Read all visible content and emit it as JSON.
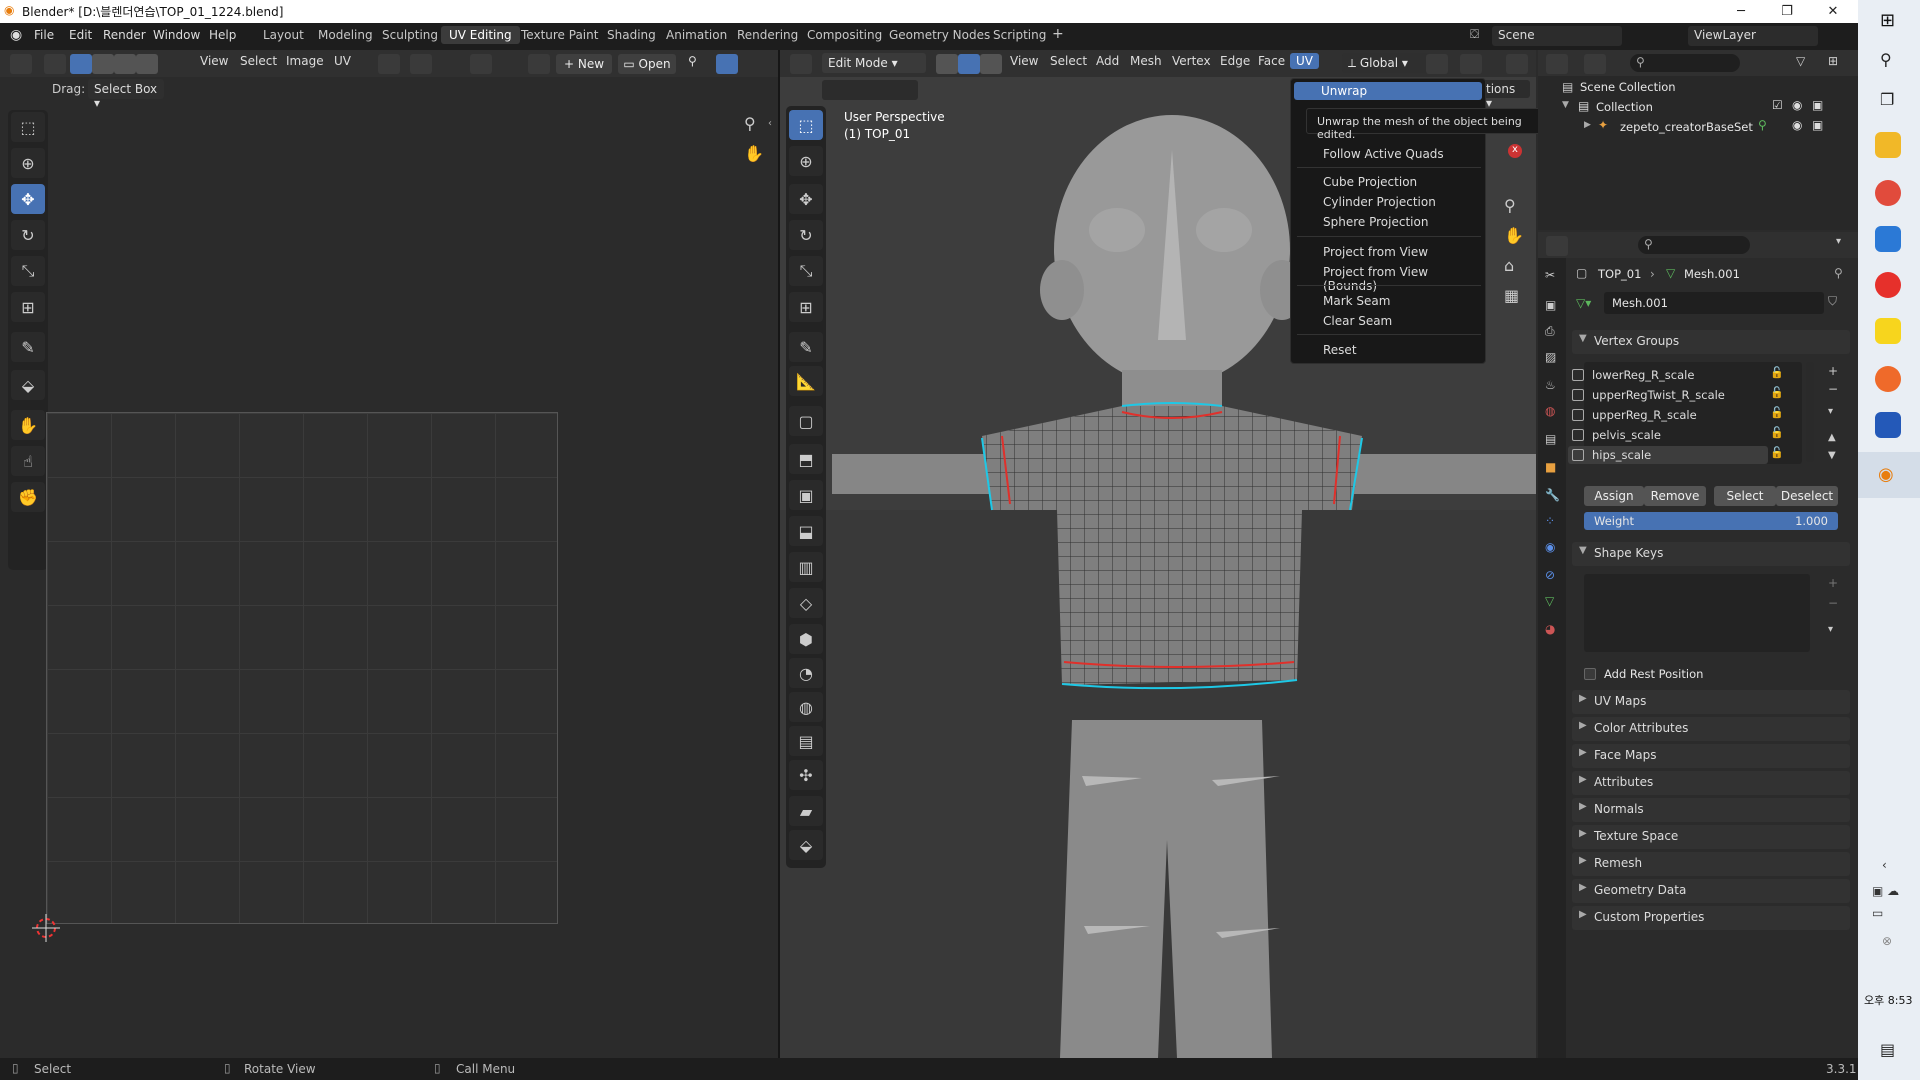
{
  "window": {
    "title": "Blender* [D:\\블렌더연습\\TOP_01_1224.blend]",
    "minimize": "─",
    "maximize": "❐",
    "close": "✕"
  },
  "menu": {
    "items": [
      "File",
      "Edit",
      "Render",
      "Window",
      "Help"
    ]
  },
  "workspaces": [
    "Layout",
    "Modeling",
    "Sculpting",
    "UV Editing",
    "Texture Paint",
    "Shading",
    "Animation",
    "Rendering",
    "Compositing",
    "Geometry Nodes",
    "Scripting"
  ],
  "active_workspace": "UV Editing",
  "scene": {
    "label": "Scene",
    "view_layer": "ViewLayer"
  },
  "uv_editor": {
    "header": {
      "view": "View",
      "select": "Select",
      "image": "Image",
      "uv": "UV",
      "new": "New",
      "open": "Open"
    },
    "drag_label": "Drag:",
    "drag_value": "Select Box"
  },
  "viewport": {
    "mode": "Edit Mode",
    "menus": [
      "View",
      "Select",
      "Add",
      "Mesh",
      "Vertex",
      "Edge",
      "Face",
      "UV"
    ],
    "orientation": "Global",
    "overlay_text": "User Perspective",
    "object_text": "(1) TOP_01",
    "options_fragment": "tions"
  },
  "uv_menu": {
    "items": [
      "Unwrap",
      "Follow Active Quads",
      "Cube Projection",
      "Cylinder Projection",
      "Sphere Projection",
      "Project from View",
      "Project from View (Bounds)",
      "Mark Seam",
      "Clear Seam",
      "Reset"
    ],
    "tooltip": "Unwrap the mesh of the object being edited."
  },
  "outliner": {
    "scene_collection": "Scene Collection",
    "collection": "Collection",
    "object": "zepeto_creatorBaseSet"
  },
  "properties": {
    "breadcrumb_object": "TOP_01",
    "breadcrumb_mesh": "Mesh.001",
    "mesh_name": "Mesh.001",
    "vertex_groups_title": "Vertex Groups",
    "vertex_groups": [
      "lowerReg_R_scale",
      "upperRegTwist_R_scale",
      "upperReg_R_scale",
      "pelvis_scale",
      "hips_scale"
    ],
    "active_group": "hips_scale",
    "buttons": {
      "assign": "Assign",
      "remove": "Remove",
      "select": "Select",
      "deselect": "Deselect"
    },
    "weight_label": "Weight",
    "weight_value": "1.000",
    "shape_keys_title": "Shape Keys",
    "add_rest_position": "Add Rest Position",
    "panels": [
      "UV Maps",
      "Color Attributes",
      "Face Maps",
      "Attributes",
      "Normals",
      "Texture Space",
      "Remesh",
      "Geometry Data",
      "Custom Properties"
    ]
  },
  "status": {
    "select": "Select",
    "rotate": "Rotate View",
    "call_menu": "Call Menu",
    "version": "3.3.1"
  },
  "taskbar": {
    "time": "오후 8:53"
  },
  "colors": {
    "accent": "#4772b3",
    "seam": "#e0302b",
    "boundary": "#1ec8e6"
  }
}
